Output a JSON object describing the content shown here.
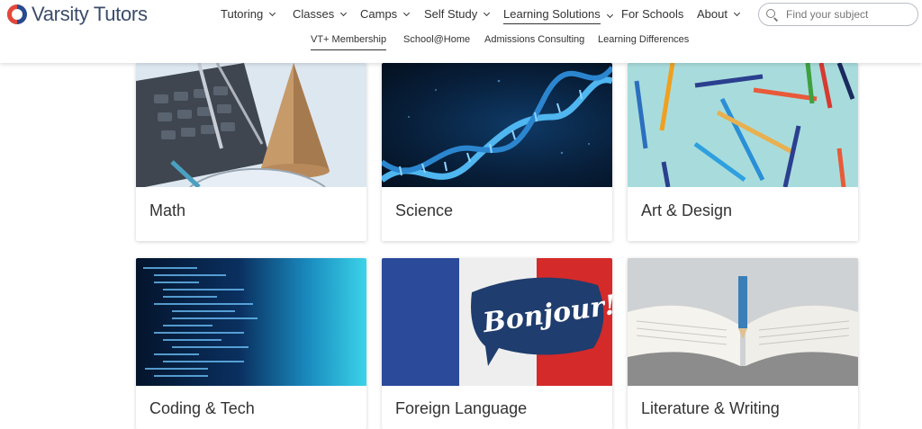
{
  "brand": {
    "name": "Varsity Tutors"
  },
  "nav": {
    "items": [
      {
        "label": "Tutoring",
        "dropdown": true
      },
      {
        "label": "Classes",
        "dropdown": true
      },
      {
        "label": "Camps",
        "dropdown": true
      },
      {
        "label": "Self Study",
        "dropdown": true
      },
      {
        "label": "Learning Solutions",
        "dropdown": true,
        "active": true
      },
      {
        "label": "For Schools",
        "dropdown": false
      },
      {
        "label": "About",
        "dropdown": true
      }
    ]
  },
  "search": {
    "placeholder": "Find your subject",
    "value": ""
  },
  "subnav": {
    "items": [
      {
        "label": "VT+ Membership",
        "active": true
      },
      {
        "label": "School@Home"
      },
      {
        "label": "Admissions Consulting"
      },
      {
        "label": "Learning Differences"
      }
    ]
  },
  "cards": [
    {
      "title": "Math"
    },
    {
      "title": "Science"
    },
    {
      "title": "Art & Design"
    },
    {
      "title": "Coding & Tech"
    },
    {
      "title": "Foreign Language",
      "image_text": "Bonjour!"
    },
    {
      "title": "Literature & Writing"
    }
  ],
  "colors": {
    "logo_red": "#e5483a",
    "logo_blue": "#2a4a8f",
    "flag_blue": "#2b4a9a",
    "flag_red": "#d42a2a"
  }
}
